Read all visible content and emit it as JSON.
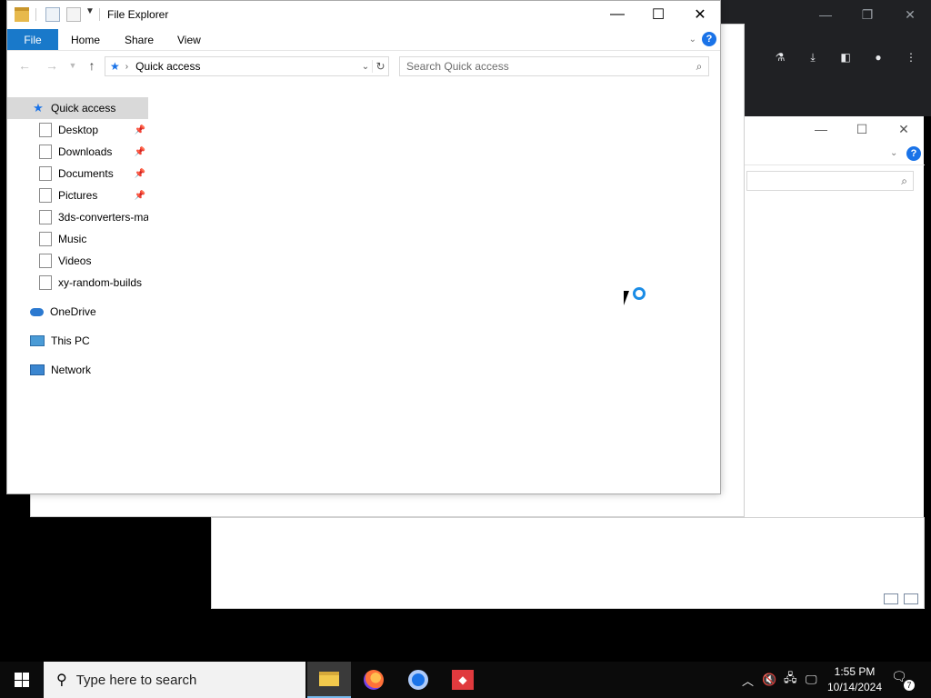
{
  "window": {
    "title": "File Explorer"
  },
  "ribbon": {
    "file_label": "File",
    "tabs": [
      "Home",
      "Share",
      "View"
    ]
  },
  "address": {
    "location": "Quick access",
    "search_placeholder": "Search Quick access"
  },
  "nav_pane": {
    "quick_access": "Quick access",
    "items": [
      {
        "label": "Desktop",
        "pinned": true
      },
      {
        "label": "Downloads",
        "pinned": true
      },
      {
        "label": "Documents",
        "pinned": true
      },
      {
        "label": "Pictures",
        "pinned": true
      },
      {
        "label": "3ds-converters-ma",
        "pinned": false
      },
      {
        "label": "Music",
        "pinned": false
      },
      {
        "label": "Videos",
        "pinned": false
      },
      {
        "label": "xy-random-builds",
        "pinned": false
      }
    ],
    "onedrive": "OneDrive",
    "this_pc": "This PC",
    "network": "Network"
  },
  "taskbar": {
    "search_placeholder": "Type here to search",
    "time": "1:55 PM",
    "date": "10/14/2024",
    "notification_count": "7"
  },
  "colors": {
    "accent": "#1979ca",
    "selection": "#d9d9d9",
    "taskbar": "#0b0b0b"
  }
}
